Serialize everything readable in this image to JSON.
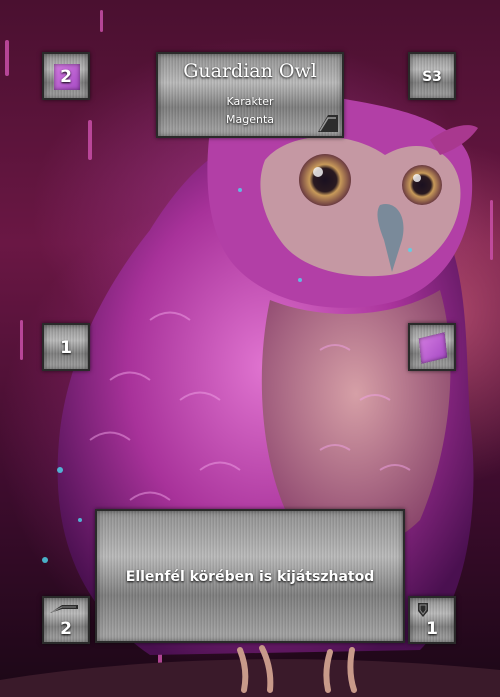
{
  "card": {
    "name": "Guardian Owl",
    "type": "Karakter",
    "color_name": "Magenta",
    "cost": "2",
    "set_code": "S3",
    "left_value": "1",
    "ability": "Ellenfél körében is kijátszhatod",
    "attack": "2",
    "defense": "1",
    "accent_color": "#c05ad6"
  }
}
